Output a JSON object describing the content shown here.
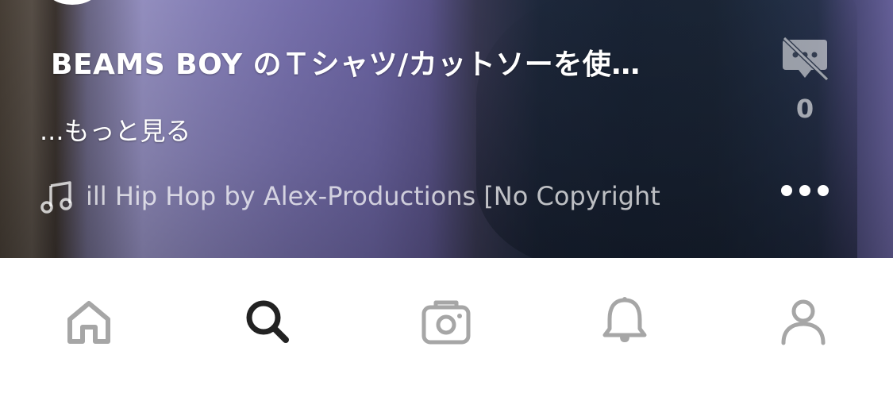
{
  "post": {
    "title": "BEAMS BOY のＴシャツ/カットソーを使…",
    "more_label": "...もっと見る",
    "music": "ill Hip Hop by Alex-Productions [No Copyright",
    "comment_count": "0"
  },
  "icons": {
    "music": "music-note-icon",
    "comment": "comment-disabled-icon",
    "more": "more-dots-icon"
  },
  "tabbar": {
    "tabs": [
      {
        "name": "home",
        "icon": "home-icon",
        "active": false
      },
      {
        "name": "search",
        "icon": "search-icon",
        "active": true
      },
      {
        "name": "camera",
        "icon": "camera-icon",
        "active": false
      },
      {
        "name": "notifications",
        "icon": "bell-icon",
        "active": false
      },
      {
        "name": "profile",
        "icon": "person-icon",
        "active": false
      }
    ],
    "active_color": "#222222",
    "inactive_color": "#a6a6a6"
  }
}
